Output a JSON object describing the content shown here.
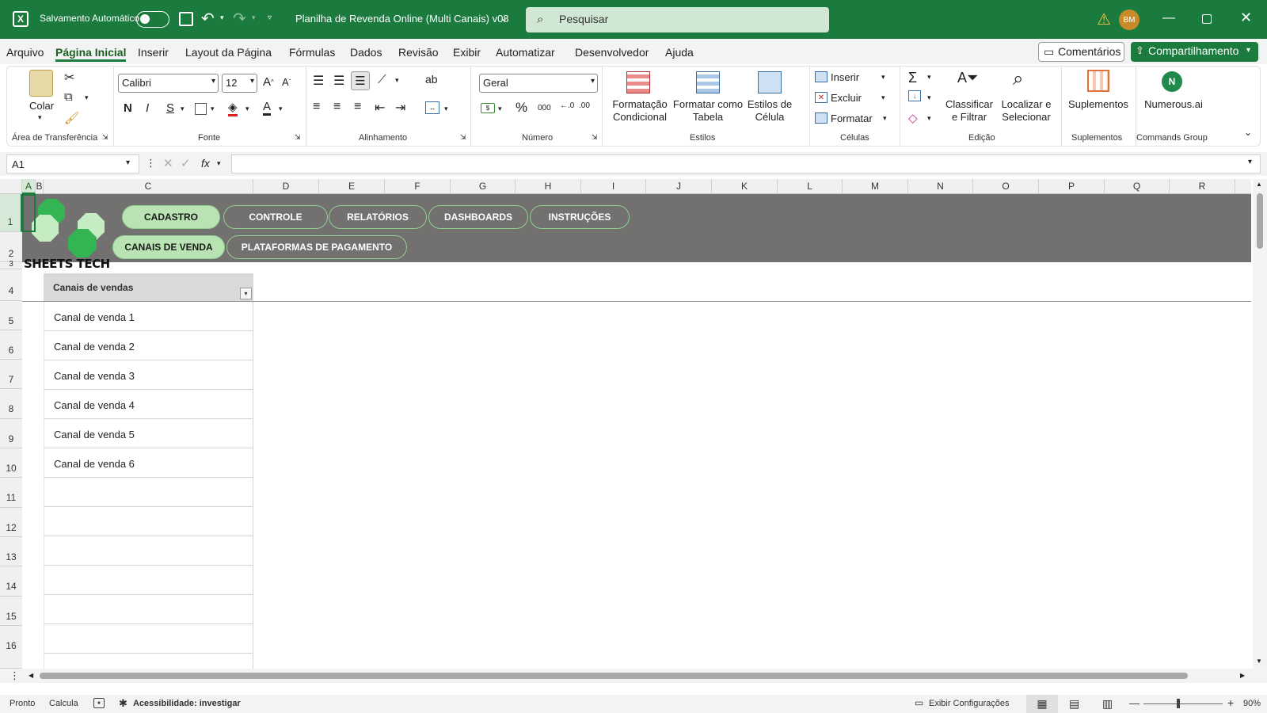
{
  "titlebar": {
    "autosave_label": "Salvamento Automático",
    "file_title": "Planilha de Revenda Online (Multi Canais) v08",
    "search_placeholder": "Pesquisar",
    "avatar_initials": "BM",
    "accent": "#1b7a3e"
  },
  "menu": {
    "tabs": [
      "Arquivo",
      "Página Inicial",
      "Inserir",
      "Layout da Página",
      "Fórmulas",
      "Dados",
      "Revisão",
      "Exibir",
      "Automatizar",
      "Desenvolvedor",
      "Ajuda"
    ],
    "active_tab": "Página Inicial",
    "comments_label": "Comentários",
    "share_label": "Compartilhamento"
  },
  "ribbon": {
    "clipboard": {
      "paste_label": "Colar",
      "group_label": "Área de Transferência"
    },
    "font": {
      "font_name": "Calibri",
      "font_size": "12",
      "bold": "N",
      "italic": "I",
      "underline": "S",
      "group_label": "Fonte"
    },
    "alignment": {
      "group_label": "Alinhamento"
    },
    "number": {
      "format": "Geral",
      "percent": "%",
      "thousands": "000",
      "group_label": "Número"
    },
    "styles": {
      "conditional_1": "Formatação",
      "conditional_2": "Condicional",
      "table_1": "Formatar como",
      "table_2": "Tabela",
      "cell_1": "Estilos de",
      "cell_2": "Célula",
      "group_label": "Estilos"
    },
    "cells": {
      "insert": "Inserir",
      "delete": "Excluir",
      "format": "Formatar",
      "group_label": "Células"
    },
    "editing": {
      "sort_1": "Classificar",
      "sort_2": "e Filtrar",
      "find_1": "Localizar e",
      "find_2": "Selecionar",
      "group_label": "Edição"
    },
    "addins": {
      "label": "Suplementos",
      "group_label": "Suplementos"
    },
    "commands": {
      "label": "Numerous.ai",
      "group_label": "Commands Group"
    }
  },
  "formula_bar": {
    "name_box": "A1",
    "fx": "fx"
  },
  "columns": [
    "A",
    "B",
    "C",
    "D",
    "E",
    "F",
    "G",
    "H",
    "I",
    "J",
    "K",
    "L",
    "M",
    "N",
    "O",
    "P",
    "Q",
    "R"
  ],
  "rows": [
    "1",
    "2",
    "3",
    "4",
    "5",
    "6",
    "7",
    "8",
    "9",
    "10",
    "11",
    "12",
    "13",
    "14",
    "15",
    "16"
  ],
  "sheet": {
    "logo_text": "SHEETS TECH",
    "nav_top": [
      "CADASTRO",
      "CONTROLE",
      "RELATÓRIOS",
      "DASHBOARDS",
      "INSTRUÇÕES"
    ],
    "nav_bottom": [
      "CANAIS DE VENDA",
      "PLATAFORMAS DE PAGAMENTO"
    ],
    "table_header": "Canais de vendas",
    "table_rows": [
      "Canal de venda 1",
      "Canal de venda 2",
      "Canal de venda 3",
      "Canal de venda 4",
      "Canal de venda 5",
      "Canal de venda 6"
    ]
  },
  "status": {
    "ready": "Pronto",
    "calc": "Calcula",
    "accessibility": "Acessibilidade: investigar",
    "display_settings": "Exibir Configurações",
    "zoom": "90%"
  }
}
